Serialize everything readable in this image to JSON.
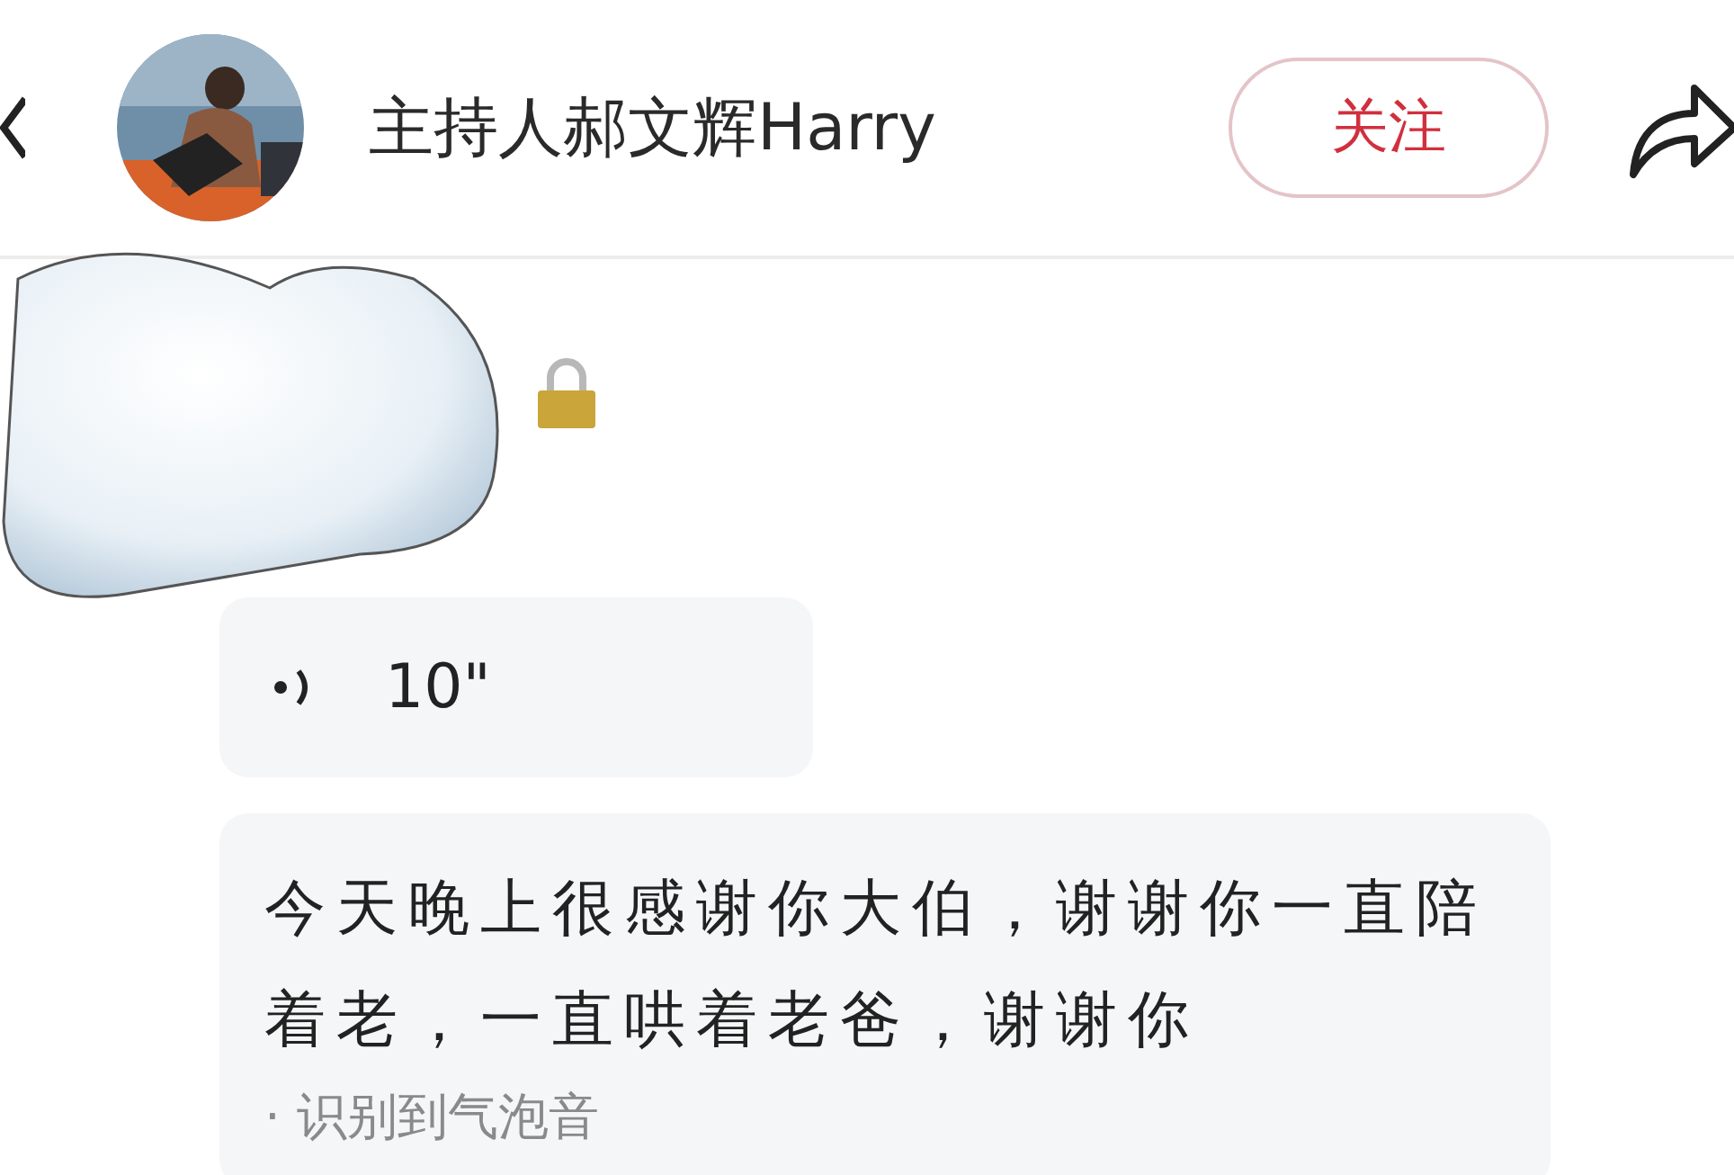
{
  "header": {
    "name": "主持人郝文辉Harry",
    "follow_button": "关注"
  },
  "messages": [
    {
      "kind": "locked"
    },
    {
      "kind": "voice",
      "duration": "10\""
    },
    {
      "kind": "transcript",
      "text": "今天晚上很感谢你大伯，谢谢你一直陪着老，一直哄着老爸，谢谢你",
      "note": "· 识别到气泡音"
    }
  ]
}
